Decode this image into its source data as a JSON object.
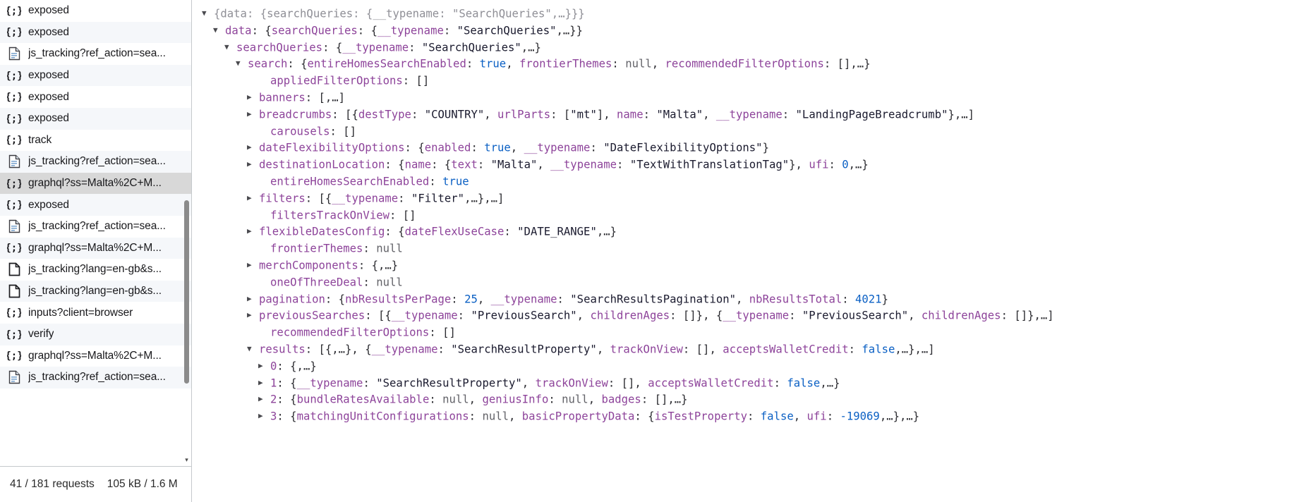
{
  "sidebar": {
    "requests": [
      {
        "icon": "json-icon",
        "label": "exposed",
        "selected": false
      },
      {
        "icon": "json-icon",
        "label": "exposed",
        "selected": false
      },
      {
        "icon": "document-icon",
        "label": "js_tracking?ref_action=sea...",
        "selected": false
      },
      {
        "icon": "json-icon",
        "label": "exposed",
        "selected": false
      },
      {
        "icon": "json-icon",
        "label": "exposed",
        "selected": false
      },
      {
        "icon": "json-icon",
        "label": "exposed",
        "selected": false
      },
      {
        "icon": "json-icon",
        "label": "track",
        "selected": false
      },
      {
        "icon": "document-icon",
        "label": "js_tracking?ref_action=sea...",
        "selected": false
      },
      {
        "icon": "json-icon",
        "label": "graphql?ss=Malta%2C+M...",
        "selected": true
      },
      {
        "icon": "json-icon",
        "label": "exposed",
        "selected": false
      },
      {
        "icon": "document-icon",
        "label": "js_tracking?ref_action=sea...",
        "selected": false
      },
      {
        "icon": "json-icon",
        "label": "graphql?ss=Malta%2C+M...",
        "selected": false
      },
      {
        "icon": "plain-doc-icon",
        "label": "js_tracking?lang=en-gb&s...",
        "selected": false
      },
      {
        "icon": "plain-doc-icon",
        "label": "js_tracking?lang=en-gb&s...",
        "selected": false
      },
      {
        "icon": "json-icon",
        "label": "inputs?client=browser",
        "selected": false
      },
      {
        "icon": "json-icon",
        "label": "verify",
        "selected": false
      },
      {
        "icon": "json-icon",
        "label": "graphql?ss=Malta%2C+M...",
        "selected": false
      },
      {
        "icon": "document-icon",
        "label": "js_tracking?ref_action=sea...",
        "selected": false
      }
    ],
    "status": {
      "requests": "41 / 181 requests",
      "transfer": "105 kB / 1.6 M"
    },
    "scroll_down_glyph": "▾"
  },
  "json_tree": {
    "rows": [
      {
        "indent": 0,
        "twisty": "expanded",
        "text_html": "<span class=\"grey\">{data: {searchQueries: {__typename: \"SearchQueries\",…}}}</span>"
      },
      {
        "indent": 1,
        "twisty": "expanded",
        "text_html": "<span class=\"k\">data</span><span class=\"pn\">: {</span><span class=\"k\">searchQueries</span><span class=\"pn\">: {</span><span class=\"k\">__typename</span><span class=\"pn\">: </span><span class=\"str\">\"SearchQueries\"</span><span class=\"pn\">,…}}</span>"
      },
      {
        "indent": 2,
        "twisty": "expanded",
        "text_html": "<span class=\"k\">searchQueries</span><span class=\"pn\">: {</span><span class=\"k\">__typename</span><span class=\"pn\">: </span><span class=\"str\">\"SearchQueries\"</span><span class=\"pn\">,…}</span>"
      },
      {
        "indent": 3,
        "twisty": "expanded",
        "text_html": "<span class=\"k\">search</span><span class=\"pn\">: {</span><span class=\"k\">entireHomesSearchEnabled</span><span class=\"pn\">: </span><span class=\"bool\">true</span><span class=\"pn\">, </span><span class=\"k\">frontierThemes</span><span class=\"pn\">: </span><span class=\"nul\">null</span><span class=\"pn\">, </span><span class=\"k\">recommendedFilterOptions</span><span class=\"pn\">: [],…}</span>"
      },
      {
        "indent": 5,
        "twisty": "none",
        "text_html": "<span class=\"k\">appliedFilterOptions</span><span class=\"pn\">: []</span>"
      },
      {
        "indent": 4,
        "twisty": "collapsed",
        "text_html": "<span class=\"k\">banners</span><span class=\"pn\">: [,…]</span>"
      },
      {
        "indent": 4,
        "twisty": "collapsed",
        "text_html": "<span class=\"k\">breadcrumbs</span><span class=\"pn\">: [{</span><span class=\"k\">destType</span><span class=\"pn\">: </span><span class=\"str\">\"COUNTRY\"</span><span class=\"pn\">, </span><span class=\"k\">urlParts</span><span class=\"pn\">: [</span><span class=\"str\">\"mt\"</span><span class=\"pn\">], </span><span class=\"k\">name</span><span class=\"pn\">: </span><span class=\"str\">\"Malta\"</span><span class=\"pn\">, </span><span class=\"k\">__typename</span><span class=\"pn\">: </span><span class=\"str\">\"LandingPageBreadcrumb\"</span><span class=\"pn\">},…]</span>"
      },
      {
        "indent": 5,
        "twisty": "none",
        "text_html": "<span class=\"k\">carousels</span><span class=\"pn\">: []</span>"
      },
      {
        "indent": 4,
        "twisty": "collapsed",
        "text_html": "<span class=\"k\">dateFlexibilityOptions</span><span class=\"pn\">: {</span><span class=\"k\">enabled</span><span class=\"pn\">: </span><span class=\"bool\">true</span><span class=\"pn\">, </span><span class=\"k\">__typename</span><span class=\"pn\">: </span><span class=\"str\">\"DateFlexibilityOptions\"</span><span class=\"pn\">}</span>"
      },
      {
        "indent": 4,
        "twisty": "collapsed",
        "text_html": "<span class=\"k\">destinationLocation</span><span class=\"pn\">: {</span><span class=\"k\">name</span><span class=\"pn\">: {</span><span class=\"k\">text</span><span class=\"pn\">: </span><span class=\"str\">\"Malta\"</span><span class=\"pn\">, </span><span class=\"k\">__typename</span><span class=\"pn\">: </span><span class=\"str\">\"TextWithTranslationTag\"</span><span class=\"pn\">}, </span><span class=\"k\">ufi</span><span class=\"pn\">: </span><span class=\"num\">0</span><span class=\"pn\">,…}</span>"
      },
      {
        "indent": 5,
        "twisty": "none",
        "text_html": "<span class=\"k\">entireHomesSearchEnabled</span><span class=\"pn\">: </span><span class=\"bool\">true</span>"
      },
      {
        "indent": 4,
        "twisty": "collapsed",
        "text_html": "<span class=\"k\">filters</span><span class=\"pn\">: [{</span><span class=\"k\">__typename</span><span class=\"pn\">: </span><span class=\"str\">\"Filter\"</span><span class=\"pn\">,…},…]</span>"
      },
      {
        "indent": 5,
        "twisty": "none",
        "text_html": "<span class=\"k\">filtersTrackOnView</span><span class=\"pn\">: []</span>"
      },
      {
        "indent": 4,
        "twisty": "collapsed",
        "text_html": "<span class=\"k\">flexibleDatesConfig</span><span class=\"pn\">: {</span><span class=\"k\">dateFlexUseCase</span><span class=\"pn\">: </span><span class=\"str\">\"DATE_RANGE\"</span><span class=\"pn\">,…}</span>"
      },
      {
        "indent": 5,
        "twisty": "none",
        "text_html": "<span class=\"k\">frontierThemes</span><span class=\"pn\">: </span><span class=\"nul\">null</span>"
      },
      {
        "indent": 4,
        "twisty": "collapsed",
        "text_html": "<span class=\"k\">merchComponents</span><span class=\"pn\">: {,…}</span>"
      },
      {
        "indent": 5,
        "twisty": "none",
        "text_html": "<span class=\"k\">oneOfThreeDeal</span><span class=\"pn\">: </span><span class=\"nul\">null</span>"
      },
      {
        "indent": 4,
        "twisty": "collapsed",
        "text_html": "<span class=\"k\">pagination</span><span class=\"pn\">: {</span><span class=\"k\">nbResultsPerPage</span><span class=\"pn\">: </span><span class=\"num\">25</span><span class=\"pn\">, </span><span class=\"k\">__typename</span><span class=\"pn\">: </span><span class=\"str\">\"SearchResultsPagination\"</span><span class=\"pn\">, </span><span class=\"k\">nbResultsTotal</span><span class=\"pn\">: </span><span class=\"num\">4021</span><span class=\"pn\">}</span>"
      },
      {
        "indent": 4,
        "twisty": "collapsed",
        "text_html": "<span class=\"k\">previousSearches</span><span class=\"pn\">: [{</span><span class=\"k\">__typename</span><span class=\"pn\">: </span><span class=\"str\">\"PreviousSearch\"</span><span class=\"pn\">, </span><span class=\"k\">childrenAges</span><span class=\"pn\">: []}, {</span><span class=\"k\">__typename</span><span class=\"pn\">: </span><span class=\"str\">\"PreviousSearch\"</span><span class=\"pn\">, </span><span class=\"k\">childrenAges</span><span class=\"pn\">: []},…]</span>"
      },
      {
        "indent": 5,
        "twisty": "none",
        "text_html": "<span class=\"k\">recommendedFilterOptions</span><span class=\"pn\">: []</span>"
      },
      {
        "indent": 4,
        "twisty": "expanded",
        "text_html": "<span class=\"k\">results</span><span class=\"pn\">: [{,…}, {</span><span class=\"k\">__typename</span><span class=\"pn\">: </span><span class=\"str\">\"SearchResultProperty\"</span><span class=\"pn\">, </span><span class=\"k\">trackOnView</span><span class=\"pn\">: [], </span><span class=\"k\">acceptsWalletCredit</span><span class=\"pn\">: </span><span class=\"bool\">false</span><span class=\"pn\">,…},…]</span>"
      },
      {
        "indent": 5,
        "twisty": "collapsed",
        "text_html": "<span class=\"idx\">0</span><span class=\"pn\">: {,…}</span>"
      },
      {
        "indent": 5,
        "twisty": "collapsed",
        "text_html": "<span class=\"idx\">1</span><span class=\"pn\">: {</span><span class=\"k\">__typename</span><span class=\"pn\">: </span><span class=\"str\">\"SearchResultProperty\"</span><span class=\"pn\">, </span><span class=\"k\">trackOnView</span><span class=\"pn\">: [], </span><span class=\"k\">acceptsWalletCredit</span><span class=\"pn\">: </span><span class=\"bool\">false</span><span class=\"pn\">,…}</span>"
      },
      {
        "indent": 5,
        "twisty": "collapsed",
        "text_html": "<span class=\"idx\">2</span><span class=\"pn\">: {</span><span class=\"k\">bundleRatesAvailable</span><span class=\"pn\">: </span><span class=\"nul\">null</span><span class=\"pn\">, </span><span class=\"k\">geniusInfo</span><span class=\"pn\">: </span><span class=\"nul\">null</span><span class=\"pn\">, </span><span class=\"k\">badges</span><span class=\"pn\">: [],…}</span>"
      },
      {
        "indent": 5,
        "twisty": "collapsed",
        "text_html": "<span class=\"idx\">3</span><span class=\"pn\">: {</span><span class=\"k\">matchingUnitConfigurations</span><span class=\"pn\">: </span><span class=\"nul\">null</span><span class=\"pn\">, </span><span class=\"k\">basicPropertyData</span><span class=\"pn\">: {</span><span class=\"k\">isTestProperty</span><span class=\"pn\">: </span><span class=\"bool\">false</span><span class=\"pn\">, </span><span class=\"k\">ufi</span><span class=\"pn\">: </span><span class=\"num\">-19069</span><span class=\"pn\">,…},…}</span>"
      }
    ],
    "twisty_expanded_glyph": "▼",
    "twisty_collapsed_glyph": "▶"
  },
  "colors": {
    "key": "#8d439a",
    "string": "#1a1a2e",
    "boolean": "#0b60c4",
    "number": "#0b60c4",
    "null": "#626268",
    "row_selected": "#d8d8d8",
    "row_alt": "#f5f7fa"
  }
}
